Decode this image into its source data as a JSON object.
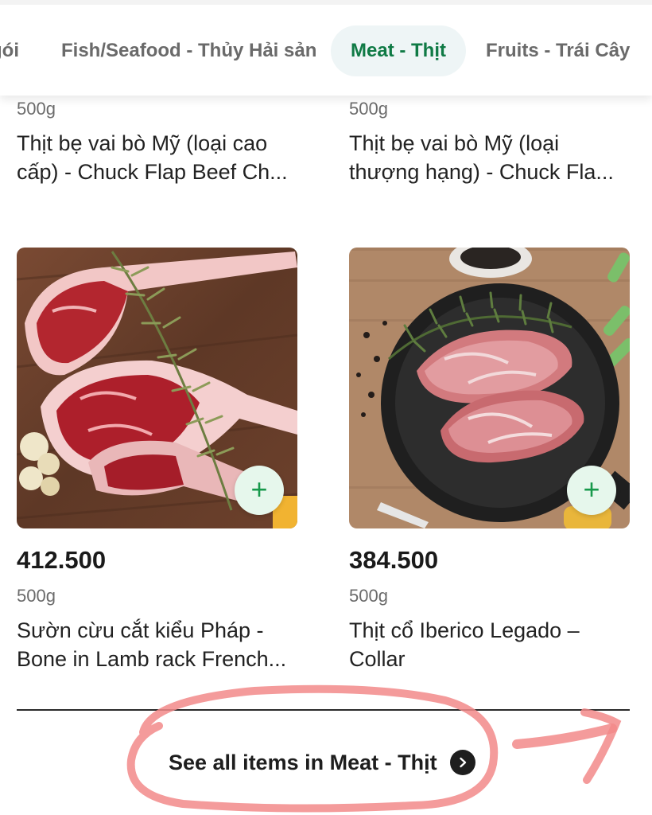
{
  "tabs": [
    {
      "label": "gói"
    },
    {
      "label": "Fish/Seafood - Thủy Hải sản"
    },
    {
      "label": "Meat - Thịt",
      "active": true
    },
    {
      "label": "Fruits - Trái Cây"
    }
  ],
  "top_products": [
    {
      "weight": "500g",
      "name": "Thịt bẹ vai bò Mỹ (loại cao cấp) - Chuck Flap Beef Ch..."
    },
    {
      "weight": "500g",
      "name": "Thịt bẹ vai bò Mỹ (loại thượng hạng) - Chuck Fla..."
    }
  ],
  "products": [
    {
      "price": "412.500",
      "weight": "500g",
      "name": "Sườn cừu cắt kiểu Pháp - Bone in Lamb rack French...",
      "image": "lamb-rack-image",
      "add_icon": "plus-icon"
    },
    {
      "price": "384.500",
      "weight": "500g",
      "name": "Thịt cổ Iberico Legado – Collar",
      "image": "iberico-collar-image",
      "add_icon": "plus-icon"
    }
  ],
  "see_all": {
    "label": "See all items in Meat - Thịt",
    "icon": "chevron-right-icon"
  },
  "colors": {
    "accent_green": "#0f7a45",
    "add_button_bg": "#e6f7ec",
    "annotation": "#f28a8a"
  }
}
